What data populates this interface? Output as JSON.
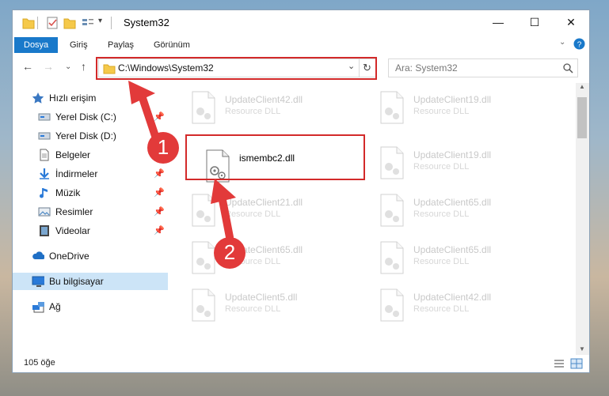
{
  "window": {
    "title": "System32"
  },
  "ribbon": {
    "tabs": [
      "Dosya",
      "Giriş",
      "Paylaş",
      "Görünüm"
    ]
  },
  "address": {
    "path": "C:\\Windows\\System32"
  },
  "search": {
    "placeholder": "Ara: System32"
  },
  "sidebar": {
    "items": [
      {
        "label": "Hızlı erişim",
        "icon": "star-icon"
      },
      {
        "label": "Yerel Disk (C:)",
        "icon": "drive-icon",
        "pinned": true
      },
      {
        "label": "Yerel Disk (D:)",
        "icon": "drive-icon"
      },
      {
        "label": "Belgeler",
        "icon": "documents-icon",
        "pinned": true
      },
      {
        "label": "İndirmeler",
        "icon": "download-icon",
        "pinned": true
      },
      {
        "label": "Müzik",
        "icon": "music-icon",
        "pinned": true
      },
      {
        "label": "Resimler",
        "icon": "pictures-icon",
        "pinned": true
      },
      {
        "label": "Videolar",
        "icon": "videos-icon",
        "pinned": true
      },
      {
        "label": "OneDrive",
        "icon": "cloud-icon"
      },
      {
        "label": "Bu bilgisayar",
        "icon": "computer-icon",
        "selected": true
      },
      {
        "label": "Ağ",
        "icon": "network-icon"
      }
    ]
  },
  "files": [
    {
      "name": "UpdateClient42.dll",
      "type": "Resource DLL",
      "faded": true
    },
    {
      "name": "UpdateClient19.dll",
      "type": "Resource DLL",
      "faded": true
    },
    {
      "name": "ismembc2.dll",
      "type": "",
      "faded": false,
      "highlighted": true
    },
    {
      "name": "UpdateClient19.dll",
      "type": "Resource DLL",
      "faded": true
    },
    {
      "name": "UpdateClient21.dll",
      "type": "Resource DLL",
      "faded": true
    },
    {
      "name": "UpdateClient65.dll",
      "type": "Resource DLL",
      "faded": true
    },
    {
      "name": "UpdateClient65.dll",
      "type": "Resource DLL",
      "faded": true
    },
    {
      "name": "UpdateClient65.dll",
      "type": "Resource DLL",
      "faded": true
    },
    {
      "name": "UpdateClient5.dll",
      "type": "Resource DLL",
      "faded": true
    },
    {
      "name": "UpdateClient42.dll",
      "type": "Resource DLL",
      "faded": true
    }
  ],
  "status": {
    "count": "105 öğe"
  },
  "annotations": {
    "step1": "1",
    "step2": "2"
  },
  "colors": {
    "accent": "#1979ca",
    "highlight": "#d32a2a",
    "selected": "#cce4f7"
  }
}
